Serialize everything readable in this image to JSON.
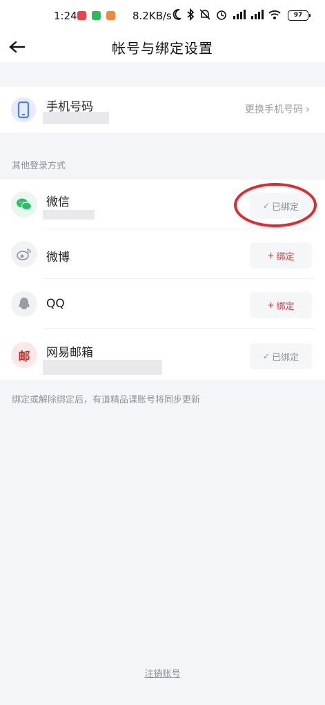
{
  "status_bar": {
    "time": "1:24",
    "net_speed": "8.2KB/s",
    "battery": "97",
    "icons": [
      "moon-icon",
      "bluetooth-icon",
      "mute-icon",
      "alarm-icon",
      "signal-icon",
      "signal-icon",
      "wifi-icon",
      "battery-icon"
    ]
  },
  "nav": {
    "back_icon": "back-arrow-icon",
    "title": "帐号与绑定设置"
  },
  "phone": {
    "icon": "phone-icon",
    "title": "手机号码",
    "action": "更换手机号码"
  },
  "section_label": "其他登录方式",
  "methods": [
    {
      "icon": "wechat-icon",
      "name": "微信",
      "button": "已绑定",
      "bound": true
    },
    {
      "icon": "weibo-icon",
      "name": "微博",
      "button": "绑定",
      "bound": false
    },
    {
      "icon": "qq-icon",
      "name": "QQ",
      "button": "绑定",
      "bound": false
    },
    {
      "icon": "mail-icon",
      "icon_text": "邮",
      "name": "网易邮箱",
      "button": "已绑定",
      "bound": true
    }
  ],
  "footnote": "绑定或解除绑定后，有道精品课账号将同步更新",
  "cancel_account": "注销账号",
  "colors": {
    "background": "#f4f5f9",
    "accent_red": "#d8343a",
    "wechat_green": "#2ac064",
    "mail_red": "#c22d2d"
  }
}
